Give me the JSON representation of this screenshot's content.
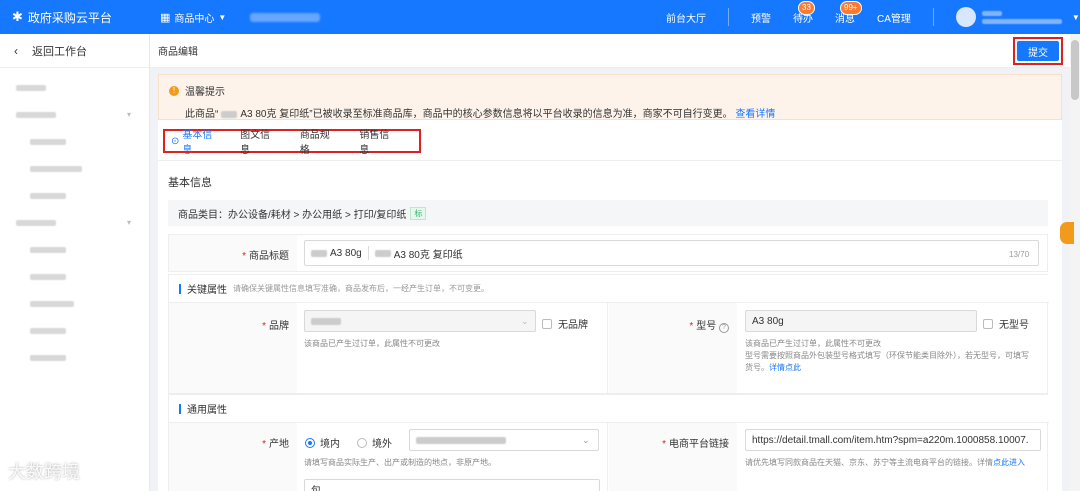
{
  "topbar": {
    "logo": "政府采购云平台",
    "center_menu": "商品中心",
    "right_items": [
      {
        "label": "前台大厅",
        "badge": ""
      },
      {
        "label": "预警",
        "badge": ""
      },
      {
        "label": "待办",
        "badge": "33"
      },
      {
        "label": "消息",
        "badge": "99+"
      },
      {
        "label": "CA管理",
        "badge": ""
      }
    ]
  },
  "sidebar": {
    "back_label": "返回工作台"
  },
  "main": {
    "page_title": "商品编辑",
    "submit_label": "提交"
  },
  "notice": {
    "title": "温馨提示",
    "text_before": "此商品“",
    "text_product": "A3 80克 复印纸",
    "text_after": "”已被收录至标准商品库，商品中的核心参数信息将以平台收录的信息为准，商家不可自行变更。",
    "link": "查看详情"
  },
  "tabs": [
    "基本信息",
    "图文信息",
    "商品规格",
    "销售信息"
  ],
  "basic": {
    "section_title": "基本信息",
    "category": "商品类目：办公设备/耗材 > 办公用纸 > 打印/复印纸",
    "category_tag": "标",
    "title_label": "商品标题",
    "title_value_a": "A3 80g",
    "title_value_b": "A3 80克 复印纸",
    "title_counter": "13/70"
  },
  "key_attrs": {
    "head": "关键属性",
    "head_sub": "请确保关键属性信息填写准确，商品发布后，一经产生订单，不可变更。",
    "brand_label": "品牌",
    "no_brand": "无品牌",
    "brand_hint": "该商品已产生过订单，此属性不可更改",
    "model_label": "型号",
    "model_value": "A3 80g",
    "no_model": "无型号",
    "model_hint_1": "该商品已产生过订单，此属性不可更改",
    "model_hint_2": "型号需要按照商品外包装型号格式填写（环保节能类目除外），若无型号，可填写",
    "model_hint_3": "货号。",
    "model_hint_link": "详情点此"
  },
  "common_attrs": {
    "head": "通用属性",
    "origin_label": "产地",
    "origin_domestic": "境内",
    "origin_foreign": "境外",
    "origin_hint": "请填写商品实际生产、出产或制造的地点，非原产地。",
    "ecom_label": "电商平台链接",
    "ecom_value": "https://detail.tmall.com/item.htm?spm=a220m.1000858.10007.",
    "ecom_hint": "请优先填写同款商品在天猫、京东、苏宁等主流电商平台的链接。详情",
    "ecom_hint_link": "点此进入",
    "unit_value": "包"
  },
  "watermark": "大数跨境",
  "colors": {
    "primary": "#1677ff",
    "highlight": "#e02020",
    "notice_bg": "#fdf3ea"
  }
}
